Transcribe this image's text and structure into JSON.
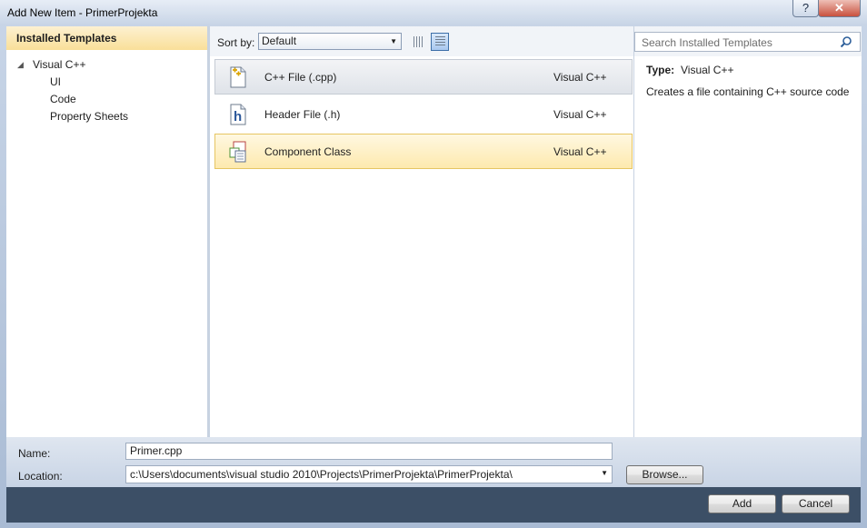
{
  "window": {
    "title": "Add New Item - PrimerProjekta",
    "help_label": "?",
    "close_label": "✕"
  },
  "left": {
    "header": "Installed Templates",
    "tree": {
      "root": "Visual C++",
      "children": [
        "UI",
        "Code",
        "Property Sheets"
      ]
    }
  },
  "center": {
    "sort_label": "Sort by:",
    "sort_value": "Default",
    "items": [
      {
        "name": "C++ File (.cpp)",
        "type": "Visual C++",
        "icon": "cpp-file-icon"
      },
      {
        "name": "Header File (.h)",
        "type": "Visual C++",
        "icon": "header-file-icon"
      },
      {
        "name": "Component Class",
        "type": "Visual C++",
        "icon": "component-class-icon"
      }
    ]
  },
  "right": {
    "search_placeholder": "Search Installed Templates",
    "type_label": "Type:",
    "type_value": "Visual C++",
    "description": "Creates a file containing C++ source code"
  },
  "bottom": {
    "name_label": "Name:",
    "name_value": "Primer.cpp",
    "location_label": "Location:",
    "location_value": "c:\\Users\\documents\\visual studio 2010\\Projects\\PrimerProjekta\\PrimerProjekta\\",
    "browse_label": "Browse...",
    "add_label": "Add",
    "cancel_label": "Cancel"
  }
}
